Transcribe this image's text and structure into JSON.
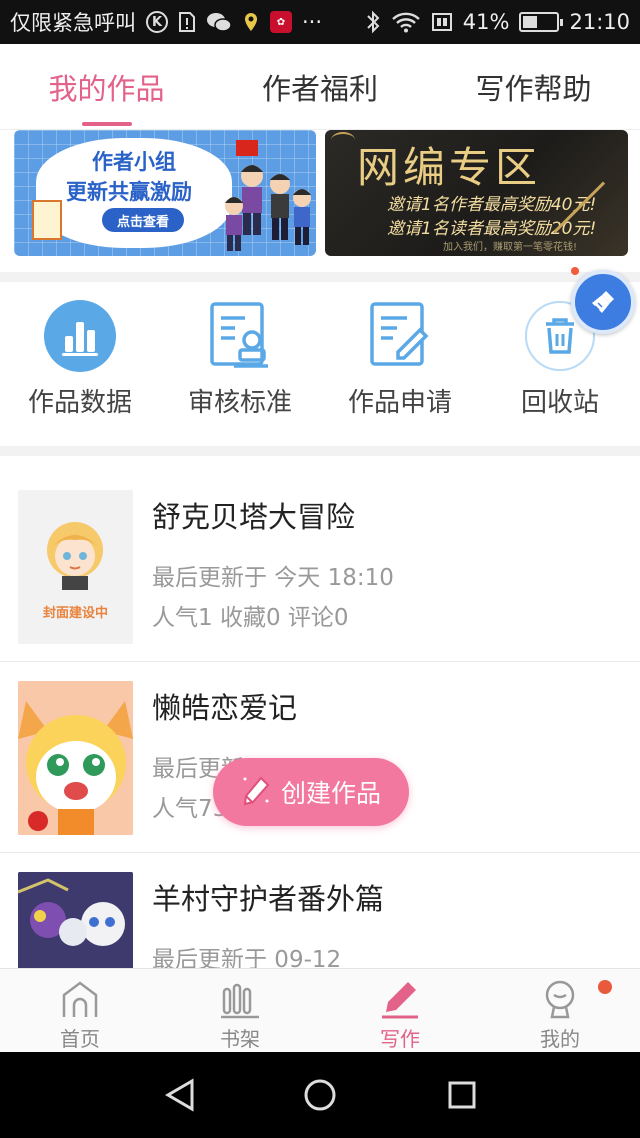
{
  "status_bar": {
    "carrier": "仅限紧急呼叫",
    "more": "···",
    "battery": "41%",
    "battery_level": 0.41,
    "time": "21:10",
    "icons": [
      "k-circle-icon",
      "sim-alert-icon",
      "wechat-icon",
      "location-icon",
      "huawei-icon",
      "bluetooth-icon",
      "wifi-icon",
      "sim-icon",
      "battery-icon"
    ]
  },
  "tabs": [
    {
      "label": "我的作品",
      "active": true
    },
    {
      "label": "作者福利",
      "active": false
    },
    {
      "label": "写作帮助",
      "active": false
    }
  ],
  "banners": {
    "left": {
      "title": "作者小组",
      "subtitle": "更新共赢激励",
      "button": "点击查看"
    },
    "right": {
      "title": "网编专区",
      "line1": "邀请1名作者最高奖励40元!",
      "line2": "邀请1名读者最高奖励20元!",
      "line3": "加入我们，赚取第一笔零花钱!"
    }
  },
  "quick_actions": [
    {
      "label": "作品数据",
      "icon": "bar-chart-icon"
    },
    {
      "label": "审核标准",
      "icon": "review-stamp-icon"
    },
    {
      "label": "作品申请",
      "icon": "edit-document-icon"
    },
    {
      "label": "回收站",
      "icon": "trash-icon"
    }
  ],
  "floating_tool": {
    "icon": "broom-icon"
  },
  "works": [
    {
      "title": "舒克贝塔大冒险",
      "updated": "最后更新于 今天 18:10",
      "stats": "人气1 收藏0 评论0",
      "cover_text": "封面建设中"
    },
    {
      "title": "懒皓恋爱记",
      "updated": "最后更新于",
      "stats": "人气73 收藏 评论2"
    },
    {
      "title": "羊村守护者番外篇",
      "updated": "最后更新于 09-12",
      "stats": ""
    }
  ],
  "create_button": {
    "label": "创建作品",
    "icon": "pencil-icon"
  },
  "bottom_nav": [
    {
      "label": "首页",
      "icon": "home-icon",
      "active": false
    },
    {
      "label": "书架",
      "icon": "bookshelf-icon",
      "active": false
    },
    {
      "label": "写作",
      "icon": "pen-icon",
      "active": true
    },
    {
      "label": "我的",
      "icon": "profile-icon",
      "active": false
    }
  ],
  "colors": {
    "accent": "#e3628a",
    "create_button": "#f278a0",
    "icon_blue": "#5aa9e6",
    "notification": "#e85a3b"
  }
}
